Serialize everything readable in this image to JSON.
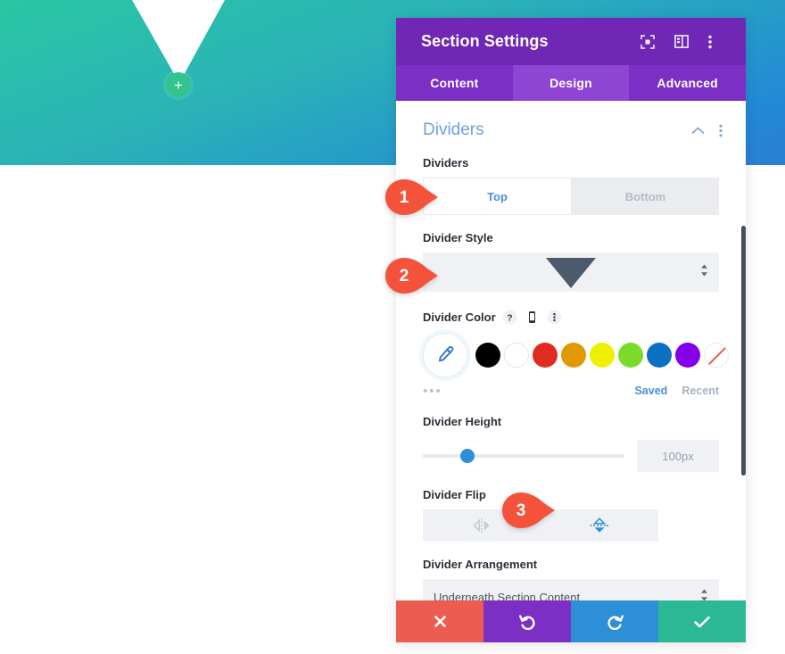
{
  "canvas": {
    "section_name": "hero-section",
    "add_button_label": "+",
    "gradient_from": "#29c6a4",
    "gradient_to": "#2b7fd4",
    "divider_color": "#ffffff",
    "add_button_color": "#31c48d"
  },
  "panel": {
    "title": "Section Settings",
    "header_icons": [
      "expand-icon",
      "layout-icon",
      "kebab-menu-icon"
    ],
    "tabs": [
      {
        "label": "Content",
        "active": false
      },
      {
        "label": "Design",
        "active": true
      },
      {
        "label": "Advanced",
        "active": false
      }
    ],
    "accent_purple": "#7027b5",
    "tab_active_bg": "#8f45d3"
  },
  "section": {
    "title": "Dividers",
    "collapse_icon": "chevron-up-icon",
    "menu_icon": "kebab-menu-icon",
    "title_color": "#6ba2d8"
  },
  "fields": {
    "dividers": {
      "label": "Dividers",
      "options": [
        {
          "label": "Top",
          "active": true
        },
        {
          "label": "Bottom",
          "active": false
        }
      ]
    },
    "divider_style": {
      "label": "Divider Style",
      "value": "",
      "preview_shape": "triangle-down",
      "preview_color": "#4c5a6b"
    },
    "divider_color": {
      "label": "Divider Color",
      "icons": [
        "help-icon",
        "mobile-icon",
        "kebab-menu-icon"
      ],
      "eyedropper_icon": "eyedropper-icon",
      "swatches": [
        {
          "name": "black",
          "hex": "#000000"
        },
        {
          "name": "white",
          "hex": "#ffffff"
        },
        {
          "name": "red",
          "hex": "#e02b20"
        },
        {
          "name": "orange",
          "hex": "#e09900"
        },
        {
          "name": "yellow",
          "hex": "#edf000"
        },
        {
          "name": "green",
          "hex": "#7cdb28"
        },
        {
          "name": "blue",
          "hex": "#0c71c3"
        },
        {
          "name": "purple",
          "hex": "#8300e9"
        },
        {
          "name": "transparent",
          "hex": "transparent"
        }
      ],
      "more_dots": "•••",
      "saved_label": "Saved",
      "recent_label": "Recent"
    },
    "divider_height": {
      "label": "Divider Height",
      "value": "100px",
      "knob_percent": 22,
      "knob_color": "#2d8fd5"
    },
    "divider_flip": {
      "label": "Divider Flip",
      "options": [
        {
          "name": "flip-horizontal-icon",
          "active": false
        },
        {
          "name": "flip-vertical-icon",
          "active": true
        }
      ],
      "active_color": "#2d8fd5",
      "inactive_color": "#c3cad3"
    },
    "divider_arrangement": {
      "label": "Divider Arrangement",
      "value": "Underneath Section Content"
    }
  },
  "footer": {
    "buttons": [
      {
        "name": "close-button",
        "icon": "close-icon",
        "color": "#ec5c50"
      },
      {
        "name": "undo-button",
        "icon": "undo-icon",
        "color": "#7b2fc4"
      },
      {
        "name": "redo-button",
        "icon": "redo-icon",
        "color": "#2d8fd5"
      },
      {
        "name": "save-button",
        "icon": "check-icon",
        "color": "#2bb894"
      }
    ]
  },
  "callouts": [
    {
      "number": "1",
      "target": "dividers-top-option",
      "color": "#f4523b"
    },
    {
      "number": "2",
      "target": "divider-style-select",
      "color": "#f4523b"
    },
    {
      "number": "3",
      "target": "divider-flip-vertical",
      "color": "#f4523b"
    }
  ]
}
